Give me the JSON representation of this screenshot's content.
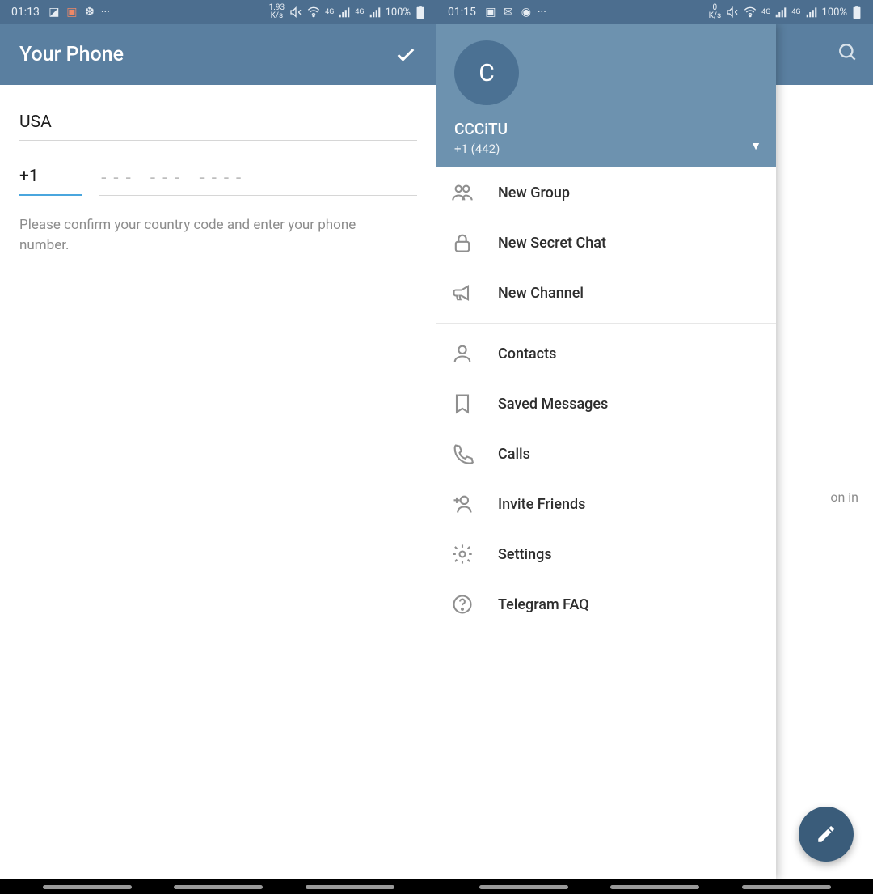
{
  "screen1": {
    "status": {
      "time": "01:13",
      "kbs": "1.93",
      "kbs_unit": "K/s",
      "battery": "100%",
      "net_label": "4G"
    },
    "header": {
      "title": "Your Phone"
    },
    "country": "USA",
    "dial_code": "+1",
    "phone_placeholder": "--- ---  ----",
    "hint": "Please confirm your country code and enter your phone number."
  },
  "screen2": {
    "status": {
      "time": "01:15",
      "kbs": "0",
      "kbs_unit": "K/s",
      "battery": "100%",
      "net_label": "4G"
    },
    "drawer": {
      "avatar_initial": "C",
      "user": "CCCiTU",
      "phone": "+1 (442)",
      "group1": [
        {
          "label": "New Group",
          "icon": "group"
        },
        {
          "label": "New Secret Chat",
          "icon": "lock"
        },
        {
          "label": "New Channel",
          "icon": "megaphone"
        }
      ],
      "group2": [
        {
          "label": "Contacts",
          "icon": "person"
        },
        {
          "label": "Saved Messages",
          "icon": "bookmark"
        },
        {
          "label": "Calls",
          "icon": "phone"
        },
        {
          "label": "Invite Friends",
          "icon": "invite"
        },
        {
          "label": "Settings",
          "icon": "gear"
        },
        {
          "label": "Telegram FAQ",
          "icon": "help"
        }
      ]
    },
    "bg_text": "on in"
  }
}
